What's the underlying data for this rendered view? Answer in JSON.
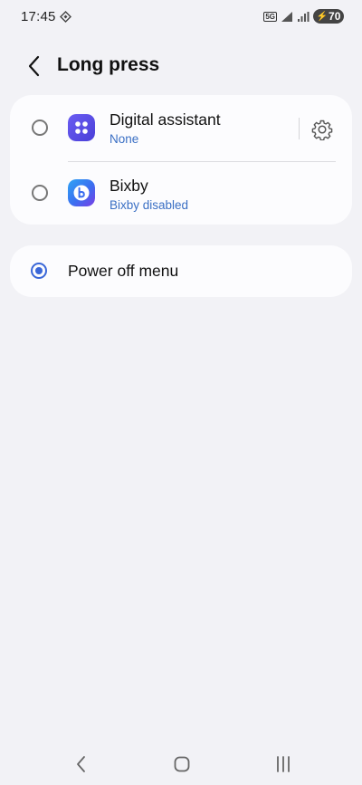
{
  "status_bar": {
    "time": "17:45",
    "network": "5G",
    "battery": "70"
  },
  "header": {
    "title": "Long press"
  },
  "options": [
    {
      "label": "Digital assistant",
      "sublabel": "None",
      "selected": false,
      "icon": "digital-assistant-icon"
    },
    {
      "label": "Bixby",
      "sublabel": "Bixby disabled",
      "selected": false,
      "icon": "bixby-icon"
    }
  ],
  "power_option": {
    "label": "Power off menu",
    "selected": true
  },
  "colors": {
    "accent": "#3a67d8",
    "sublabel": "#3a6fc4",
    "background": "#f2f2f6",
    "card": "#fcfcfe"
  },
  "nav": {
    "back_icon": "back-icon",
    "home_icon": "home-icon",
    "recents_icon": "recents-icon"
  }
}
